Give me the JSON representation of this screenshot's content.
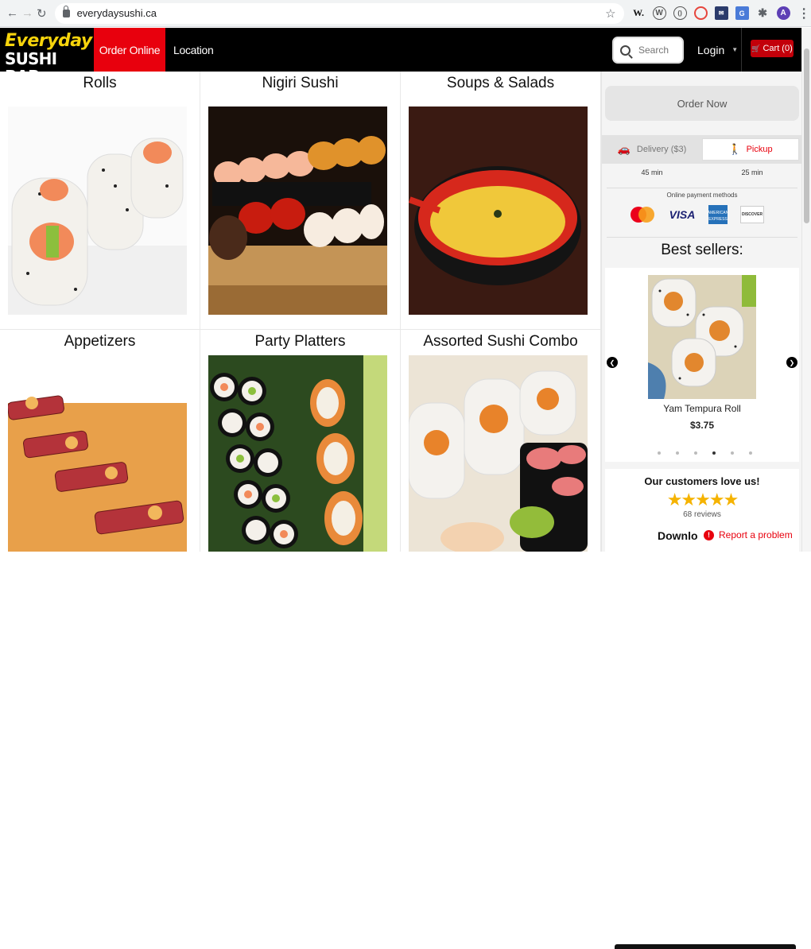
{
  "browser": {
    "url": "everydaysushi.ca"
  },
  "header": {
    "logo_line1": "Everyday",
    "logo_line2": "SUSHI BAR",
    "nav_order": "Order Online",
    "nav_location": "Location",
    "search_placeholder": "Search",
    "login": "Login",
    "cart": "Cart (0)"
  },
  "categories": [
    {
      "title": "Rolls"
    },
    {
      "title": "Nigiri Sushi"
    },
    {
      "title": "Soups & Salads"
    },
    {
      "title": "Appetizers"
    },
    {
      "title": "Party Platters"
    },
    {
      "title": "Assorted Sushi Combo"
    }
  ],
  "sidebar": {
    "order_now": "Order Now",
    "delivery_label": "Delivery ($3)",
    "pickup_label": "Pickup",
    "delivery_eta": "45 min",
    "pickup_eta": "25 min",
    "payment_title": "Online payment methods",
    "visa": "VISA",
    "amex": "AMERICAN EXPRESS",
    "discover": "DISCOVER",
    "best_sellers": "Best sellers:",
    "carousel_item": {
      "name": "Yam Tempura Roll",
      "price": "$3.75"
    },
    "carousel_dots": 6,
    "carousel_active_dot": 4,
    "love_title": "Our customers love us!",
    "stars": "★★★★★",
    "reviews": "68 reviews",
    "download": "Downlo",
    "report": "Report a problem"
  },
  "colors": {
    "brand_red": "#e8000d",
    "logo_yellow": "#f7d40c",
    "header_bg": "#000000",
    "star": "#f5b301"
  }
}
